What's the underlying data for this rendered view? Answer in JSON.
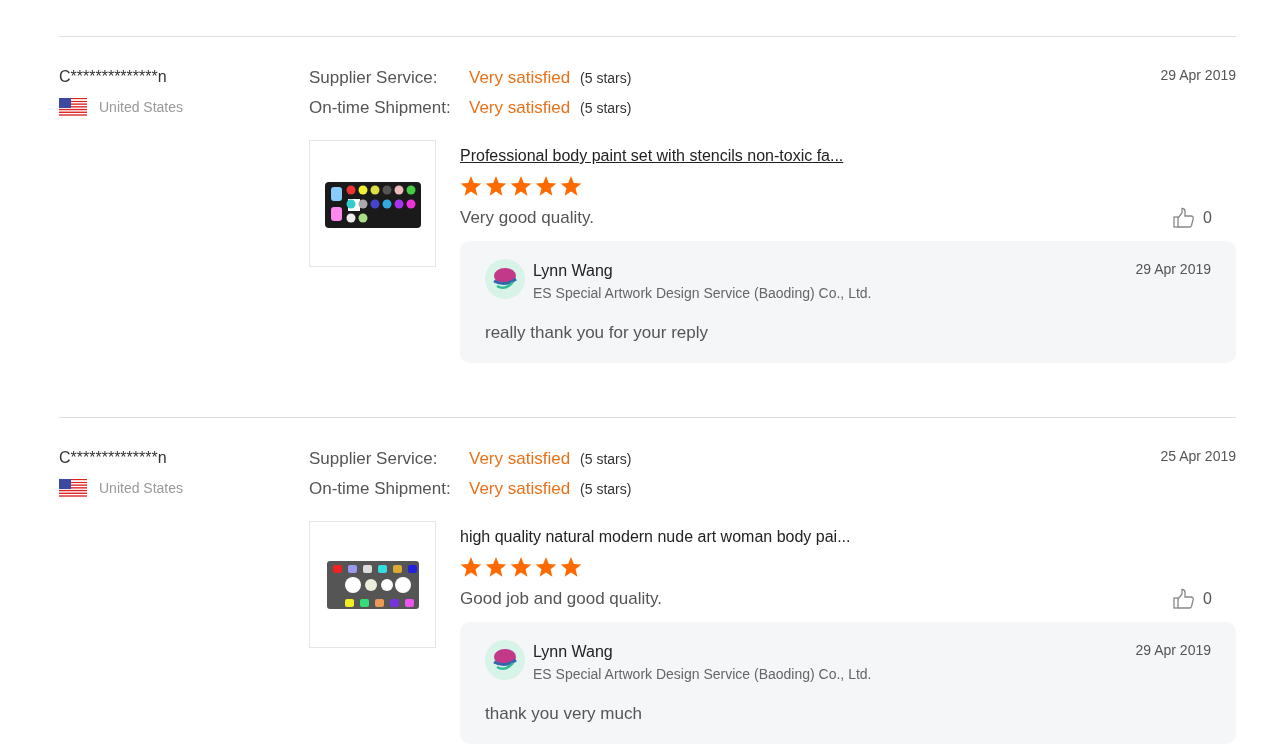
{
  "reviews": [
    {
      "buyer": "C**************n",
      "country": "United States",
      "date": "29 Apr 2019",
      "ratings": [
        {
          "label": "Supplier Service:",
          "value": "Very satisfied",
          "stars_text": "(5 stars)"
        },
        {
          "label": "On-time Shipment:",
          "value": "Very satisfied",
          "stars_text": "(5 stars)"
        }
      ],
      "product": {
        "title": "Professional body paint set with stencils non-toxic fa...",
        "hovered": true,
        "kind": "stencil"
      },
      "stars": 5,
      "comment": "Very good quality.",
      "likes": "0",
      "reply": {
        "name": "Lynn Wang",
        "company": "ES Special Artwork Design Service (Baoding) Co., Ltd.",
        "date": "29 Apr 2019",
        "text": "really thank you for your reply"
      }
    },
    {
      "buyer": "C**************n",
      "country": "United States",
      "date": "25 Apr 2019",
      "ratings": [
        {
          "label": "Supplier Service:",
          "value": "Very satisfied",
          "stars_text": "(5 stars)"
        },
        {
          "label": "On-time Shipment:",
          "value": "Very satisfied",
          "stars_text": "(5 stars)"
        }
      ],
      "product": {
        "title": "high quality natural modern nude art woman body pai...",
        "hovered": false,
        "kind": "grey"
      },
      "stars": 5,
      "comment": "Good job and good quality.",
      "likes": "0",
      "reply": {
        "name": "Lynn Wang",
        "company": "ES Special Artwork Design Service (Baoding) Co., Ltd.",
        "date": "29 Apr 2019",
        "text": "thank you very much"
      }
    }
  ]
}
